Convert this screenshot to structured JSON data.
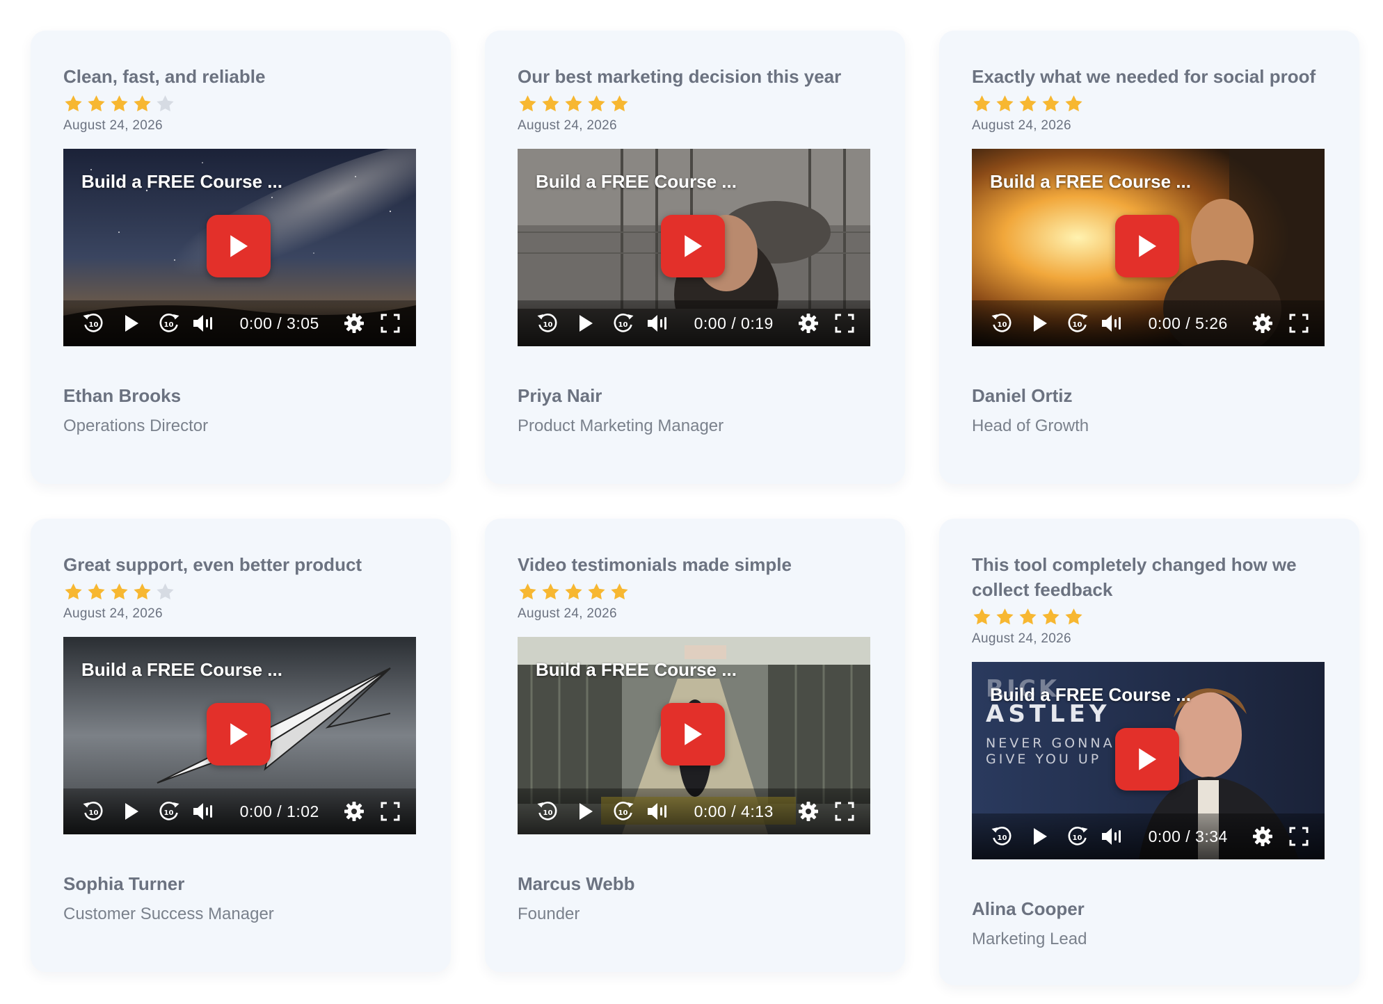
{
  "video_title": "Build a FREE Course ...",
  "colors": {
    "star_filled": "#f7b731",
    "star_empty": "#d6dbe3",
    "play_button": "#e3302a",
    "card_bg": "#f3f7fc"
  },
  "icons": {
    "rating": "star-icon",
    "play": "play-icon",
    "rewind": "rewind-10-icon",
    "forward": "forward-10-icon",
    "volume": "volume-icon",
    "settings": "gear-icon",
    "fullscreen": "fullscreen-icon"
  },
  "testimonials": [
    {
      "title": "Clean, fast, and reliable",
      "rating": 4,
      "date": "August 24, 2026",
      "time": "0:00 / 3:05",
      "author": "Ethan Brooks",
      "role": "Operations Director",
      "thumb": "space"
    },
    {
      "title": "Our best marketing decision this year",
      "rating": 5,
      "date": "August 24, 2026",
      "time": "0:00 / 0:19",
      "author": "Priya Nair",
      "role": "Product Marketing Manager",
      "thumb": "zoo"
    },
    {
      "title": "Exactly what we needed for social proof",
      "rating": 5,
      "date": "August 24, 2026",
      "time": "0:00 / 5:26",
      "author": "Daniel Ortiz",
      "role": "Head of Growth",
      "thumb": "fire"
    },
    {
      "title": "Great support, even better product",
      "rating": 4,
      "date": "August 24, 2026",
      "time": "0:00 / 1:02",
      "author": "Sophia Turner",
      "role": "Customer Success Manager",
      "thumb": "plane"
    },
    {
      "title": "Video testimonials made simple",
      "rating": 5,
      "date": "August 24, 2026",
      "time": "0:00 / 4:13",
      "author": "Marcus Webb",
      "role": "Founder",
      "thumb": "cartoon"
    },
    {
      "title": "This tool completely changed how we collect feedback",
      "rating": 5,
      "date": "August 24, 2026",
      "time": "0:00 / 3:34",
      "author": "Alina Cooper",
      "role": "Marketing Lead",
      "thumb": "rick",
      "thumb_text_1": "RICK",
      "thumb_text_2": "ASTLEY",
      "thumb_text_3": "NEVER GONNA",
      "thumb_text_4": "GIVE YOU UP"
    }
  ]
}
